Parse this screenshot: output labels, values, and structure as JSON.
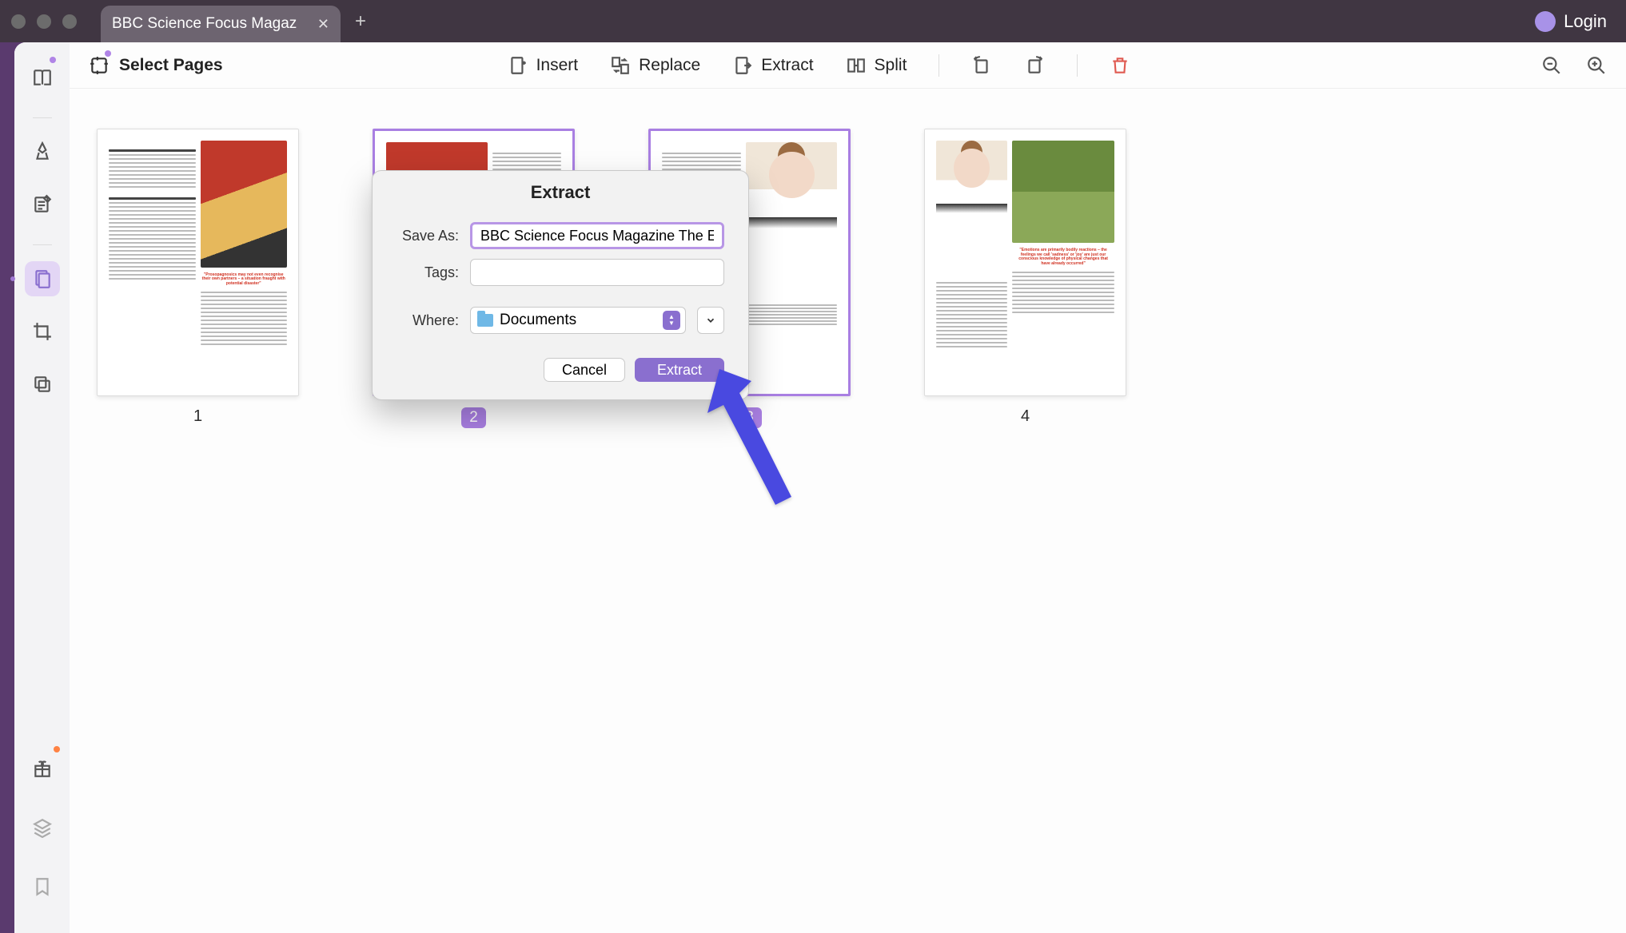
{
  "titlebar": {
    "tab_title": "BBC Science Focus Magaz",
    "login_label": "Login"
  },
  "toolbar": {
    "select_pages": "Select Pages",
    "insert": "Insert",
    "replace": "Replace",
    "extract": "Extract",
    "split": "Split"
  },
  "pages": [
    {
      "num": "1",
      "selected": false,
      "quote": "\"Prosopagnosics may not even recognise their own partners – a situation fraught with potential disaster\""
    },
    {
      "num": "2",
      "selected": true
    },
    {
      "num": "3",
      "selected": true
    },
    {
      "num": "4",
      "selected": false,
      "quote": "\"Emotions are primarily bodily reactions – the feelings we call 'sadness' or 'joy' are just our conscious knowledge of physical changes that have already occurred\""
    }
  ],
  "modal": {
    "title": "Extract",
    "save_as_label": "Save As:",
    "save_as_value": "BBC Science Focus Magazine The E",
    "tags_label": "Tags:",
    "where_label": "Where:",
    "where_value": "Documents",
    "cancel": "Cancel",
    "confirm": "Extract"
  }
}
